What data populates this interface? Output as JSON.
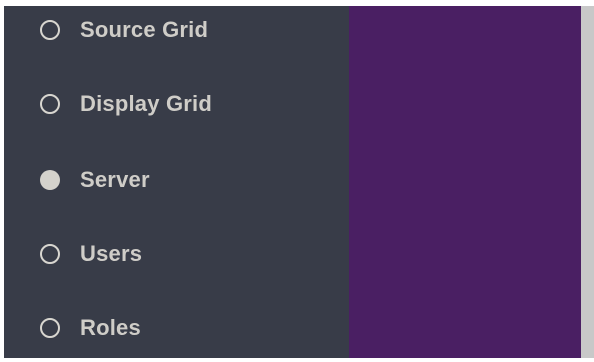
{
  "sidebar": {
    "items": [
      {
        "label": "Source Grid",
        "selected": false
      },
      {
        "label": "Display Grid",
        "selected": false
      },
      {
        "label": "Server",
        "selected": true
      },
      {
        "label": "Users",
        "selected": false
      },
      {
        "label": "Roles",
        "selected": false
      }
    ]
  },
  "colors": {
    "sidebar_bg": "#383c48",
    "content_bg": "#4a1f63",
    "label_text": "#cfcdc8",
    "radio": "#d4d2cc"
  }
}
